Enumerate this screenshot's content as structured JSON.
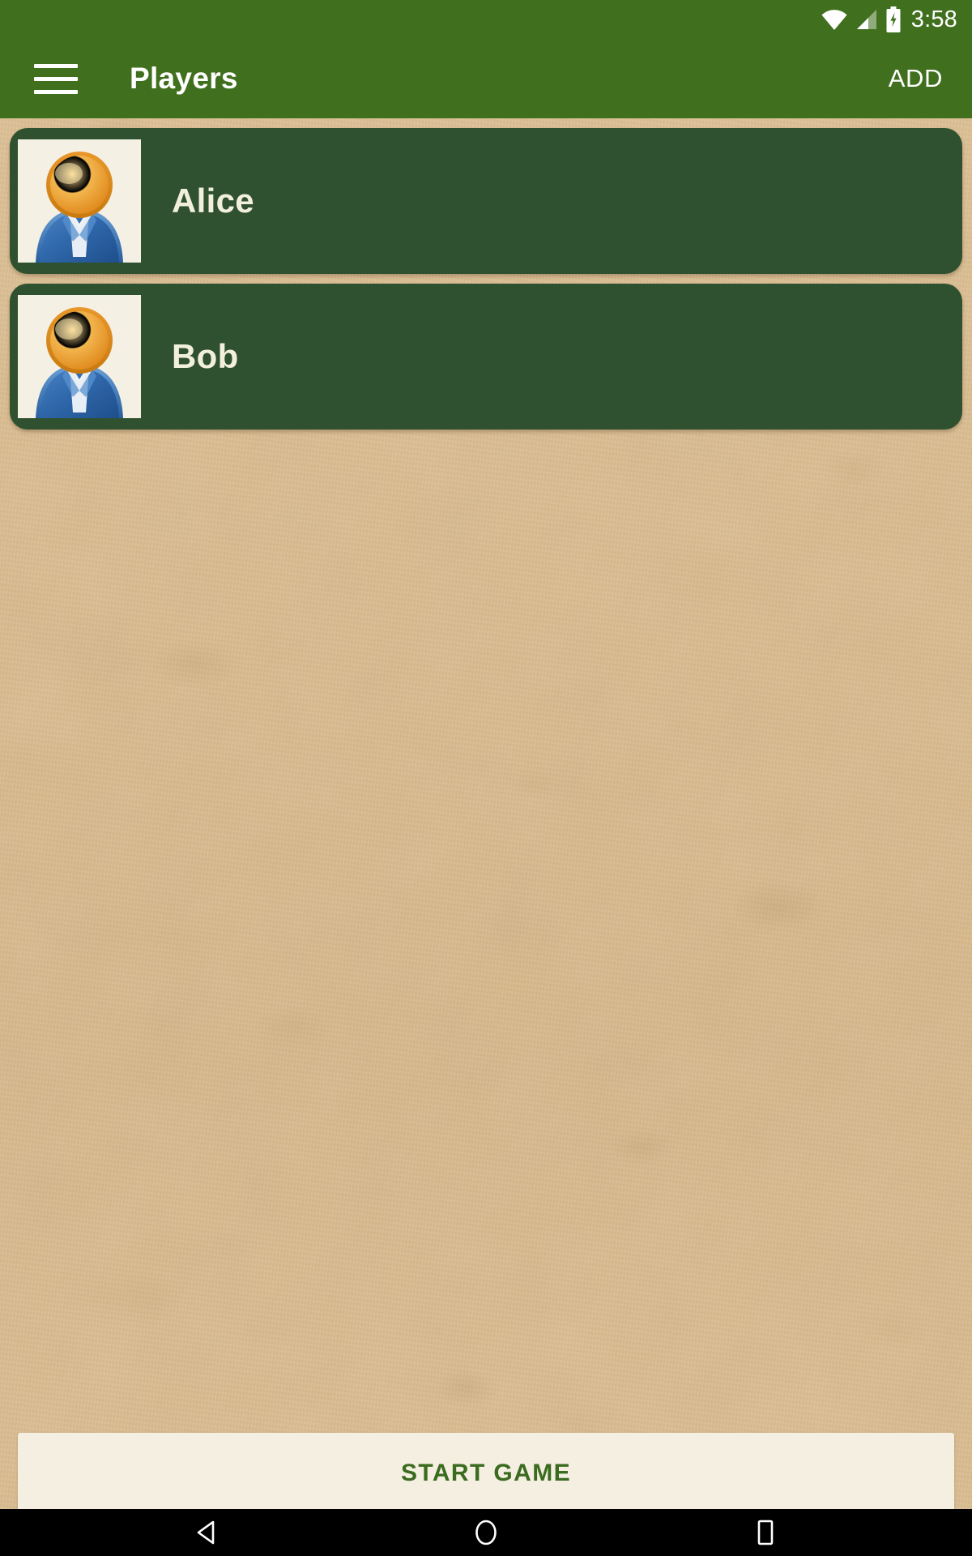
{
  "status_bar": {
    "time": "3:58",
    "icons": [
      "wifi-icon",
      "cellular-signal-icon",
      "battery-charging-icon"
    ]
  },
  "app_bar": {
    "menu_icon": "hamburger-menu-icon",
    "title": "Players",
    "action_label": "ADD"
  },
  "players": [
    {
      "name": "Alice",
      "avatar_icon": "person-avatar-icon"
    },
    {
      "name": "Bob",
      "avatar_icon": "person-avatar-icon"
    }
  ],
  "start_button": {
    "label": "START GAME"
  },
  "nav_bar": {
    "back": "back-triangle-icon",
    "home": "home-circle-icon",
    "recents": "recents-square-icon"
  },
  "colors": {
    "app_bar_green": "#40701e",
    "card_green": "#2f5130",
    "paper_tan": "#dcbc8c",
    "cream": "#f5efe1",
    "name_text": "#f2efdf",
    "start_text_green": "#3a6b1f"
  }
}
